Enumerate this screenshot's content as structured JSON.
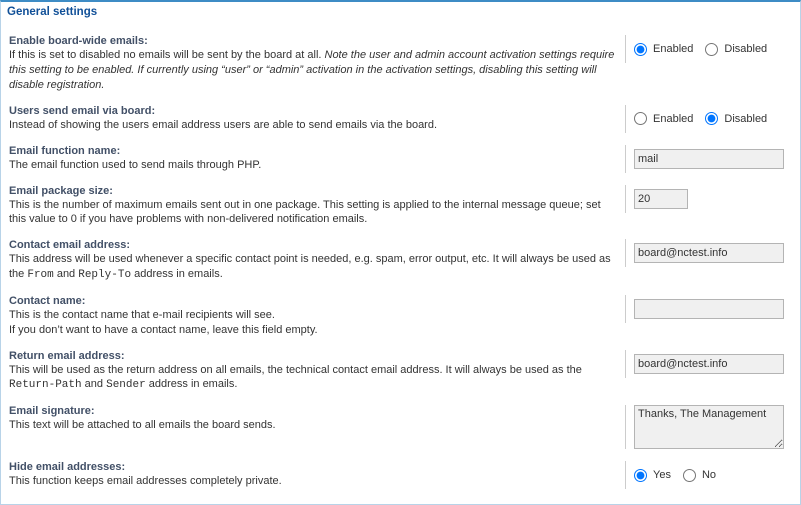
{
  "panel_title": "General settings",
  "radio": {
    "enabled": "Enabled",
    "disabled": "Disabled",
    "yes": "Yes",
    "no": "No"
  },
  "settings": {
    "enable_emails": {
      "label": "Enable board-wide emails:",
      "desc_prefix": "If this is set to disabled no emails will be sent by the board at all. ",
      "desc_italic": "Note the user and admin account activation settings require this setting to be enabled. If currently using “user” or “admin” activation in the activation settings, disabling this setting will disable registration."
    },
    "users_send_via_board": {
      "label": "Users send email via board:",
      "desc": "Instead of showing the users email address users are able to send emails via the board."
    },
    "email_function_name": {
      "label": "Email function name:",
      "desc": "The email function used to send mails through PHP.",
      "value": "mail"
    },
    "email_package_size": {
      "label": "Email package size:",
      "desc": "This is the number of maximum emails sent out in one package. This setting is applied to the internal message queue; set this value to 0 if you have problems with non-delivered notification emails.",
      "value": "20"
    },
    "contact_email": {
      "label": "Contact email address:",
      "desc_prefix": "This address will be used whenever a specific contact point is needed, e.g. spam, error output, etc. It will always be used as the ",
      "from": "From",
      "and": " and ",
      "replyto": "Reply-To",
      "desc_suffix": " address in emails.",
      "value": "board@nctest.info"
    },
    "contact_name": {
      "label": "Contact name:",
      "desc": "This is the contact name that e-mail recipients will see.\nIf you don’t want to have a contact name, leave this field empty.",
      "value": ""
    },
    "return_email": {
      "label": "Return email address:",
      "desc_prefix": "This will be used as the return address on all emails, the technical contact email address. It will always be used as the ",
      "returnpath": "Return-Path",
      "and": " and ",
      "sender": "Sender",
      "desc_suffix": " address in emails.",
      "value": "board@nctest.info"
    },
    "email_sig": {
      "label": "Email signature:",
      "desc": "This text will be attached to all emails the board sends.",
      "value": "Thanks, The Management"
    },
    "hide_emails": {
      "label": "Hide email addresses:",
      "desc": "This function keeps email addresses completely private."
    }
  }
}
